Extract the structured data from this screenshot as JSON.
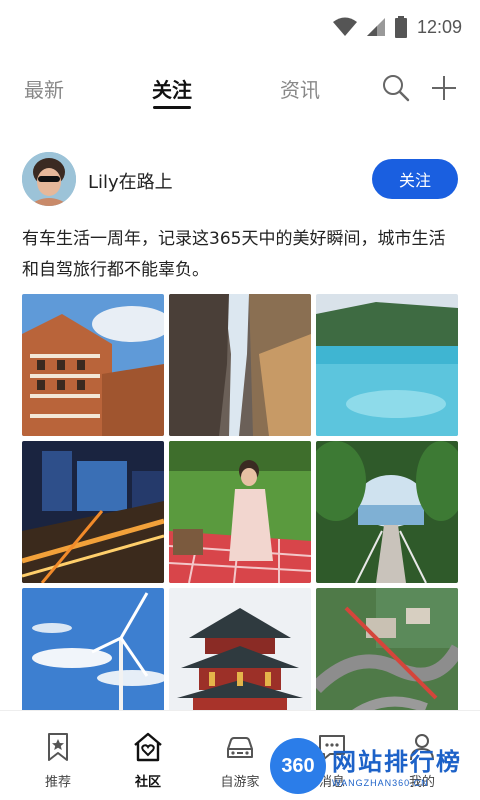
{
  "status_bar": {
    "time": "12:09",
    "icons": [
      "wifi-icon",
      "signal-icon",
      "battery-icon"
    ]
  },
  "top_tabs": {
    "items": [
      {
        "label": "最新",
        "active": false
      },
      {
        "label": "关注",
        "active": true
      },
      {
        "label": "资讯",
        "active": false
      }
    ],
    "actions": [
      "search-icon",
      "plus-icon"
    ]
  },
  "post": {
    "username": "Lily在路上",
    "follow_label": "关注",
    "text": "有车生活一周年，记录这365天中的美好瞬间，城市生活和自驾旅行都不能辜负。",
    "photos": [
      "building-photo",
      "canyon-photo",
      "lake-photo",
      "city-night-photo",
      "picnic-photo",
      "garden-path-photo",
      "wind-turbine-photo",
      "pavilion-photo",
      "aerial-road-photo"
    ]
  },
  "bottom_nav": {
    "items": [
      {
        "label": "推荐",
        "icon": "bookmark-star-icon",
        "active": false
      },
      {
        "label": "社区",
        "icon": "home-heart-icon",
        "active": true
      },
      {
        "label": "自游家",
        "icon": "car-icon",
        "active": false
      },
      {
        "label": "消息",
        "icon": "message-icon",
        "active": false
      },
      {
        "label": "我的",
        "icon": "profile-icon",
        "active": false
      }
    ]
  },
  "watermark": {
    "badge": "360",
    "title": "网站排行榜",
    "subtitle": "WANGZHAN360.CN"
  },
  "colors": {
    "accent": "#1a5fe0",
    "text": "#222222",
    "muted": "#888888"
  }
}
